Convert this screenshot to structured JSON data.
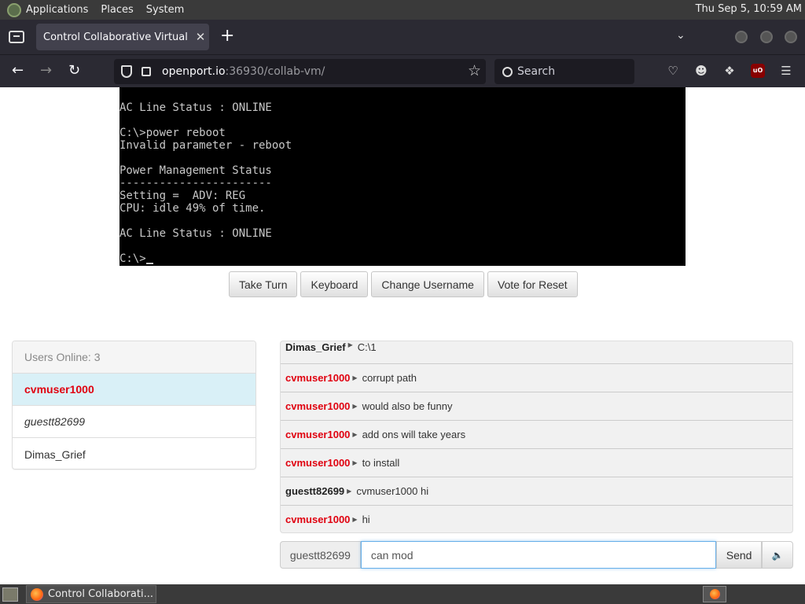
{
  "top_panel": {
    "menus": [
      "Applications",
      "Places",
      "System"
    ],
    "clock": "Thu Sep  5, 10:59 AM"
  },
  "browser": {
    "tab_title": "Control Collaborative Virtual M",
    "tab_close": "✕",
    "new_tab": "+",
    "url_host": "openport.io",
    "url_rest": ":36930/collab-vm/",
    "search_placeholder": "Search"
  },
  "vm_console": {
    "lines": [
      "AC Line Status : ONLINE",
      "",
      "C:\\>power reboot",
      "Invalid parameter - reboot",
      "",
      "Power Management Status",
      "-----------------------",
      "Setting =  ADV: REG",
      "CPU: idle 49% of time.",
      "",
      "AC Line Status : ONLINE",
      "",
      "C:\\>"
    ]
  },
  "controls": {
    "take_turn": "Take Turn",
    "keyboard": "Keyboard",
    "change_username": "Change Username",
    "vote_reset": "Vote for Reset"
  },
  "users": {
    "header": "Users Online: 3",
    "list": [
      {
        "name": "cvmuser1000",
        "status": "turn"
      },
      {
        "name": "guestt82699",
        "status": "guest"
      },
      {
        "name": "Dimas_Grief",
        "status": "normal"
      }
    ]
  },
  "chat": {
    "messages": [
      {
        "user": "Dimas_Grief",
        "text": "C:\\1",
        "red": false
      },
      {
        "user": "cvmuser1000",
        "text": "corrupt path",
        "red": true
      },
      {
        "user": "cvmuser1000",
        "text": "would also be funny",
        "red": true
      },
      {
        "user": "cvmuser1000",
        "text": "add ons will take years",
        "red": true
      },
      {
        "user": "cvmuser1000",
        "text": "to install",
        "red": true
      },
      {
        "user": "guestt82699",
        "text": "cvmuser1000 hi",
        "red": false
      },
      {
        "user": "cvmuser1000",
        "text": "hi",
        "red": true
      }
    ],
    "username_addon": "guestt82699",
    "input_value": "can mod",
    "send_label": "Send",
    "sound_icon": "🔊"
  },
  "taskbar": {
    "task_title": "Control Collaborati..."
  },
  "colors": {
    "turn_user": "#e0000f",
    "turn_bg": "#d9f0f7"
  }
}
